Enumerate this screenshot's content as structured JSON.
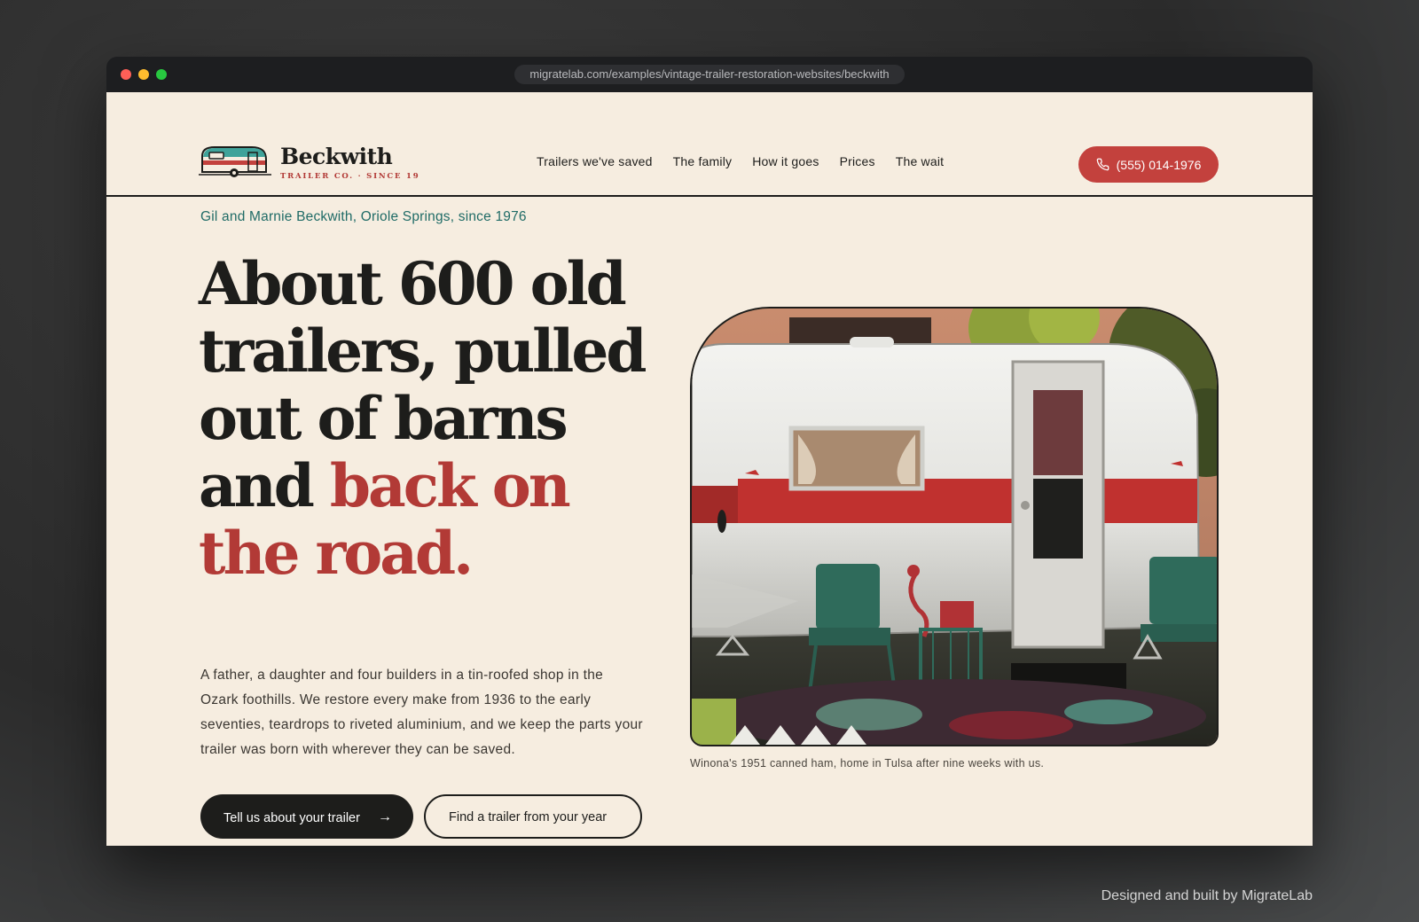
{
  "browser": {
    "url": "migratelab.com/examples/vintage-trailer-restoration-websites/beckwith"
  },
  "brand": {
    "name": "Beckwith",
    "tagline": "TRAILER CO. · SINCE 19",
    "logo_icon": "trailer-icon"
  },
  "nav": {
    "items": [
      {
        "label": "Trailers we've saved"
      },
      {
        "label": "The family"
      },
      {
        "label": "How it goes"
      },
      {
        "label": "Prices"
      },
      {
        "label": "The wait"
      }
    ]
  },
  "phone": {
    "label": "(555) 014-1976",
    "icon": "phone-icon"
  },
  "hero": {
    "eyebrow": "Gil and Marnie Beckwith, Oriole Springs, since 1976",
    "headline_dark": "About 600 old trailers, pulled out of barns and",
    "headline_accent": "back on the road.",
    "body": "A father, a daughter and four builders in a tin-roofed shop in the Ozark foothills. We restore every make from 1936 to the early seventies, teardrops to riveted aluminium, and we keep the parts your trailer was born with wherever they can be saved.",
    "cta_primary": "Tell us about your trailer",
    "cta_primary_icon": "arrow-right-icon",
    "cta_secondary": "Find a trailer from your year",
    "image_caption": "Winona's 1951 canned ham, home in Tulsa after nine weeks with us."
  },
  "footer": {
    "credit": "Designed and built by MigrateLab"
  },
  "colors": {
    "background": "#f6ede0",
    "ink": "#1d1d1b",
    "accent_red": "#b23a36",
    "button_red": "#c3413d",
    "teal": "#1f6b66"
  }
}
